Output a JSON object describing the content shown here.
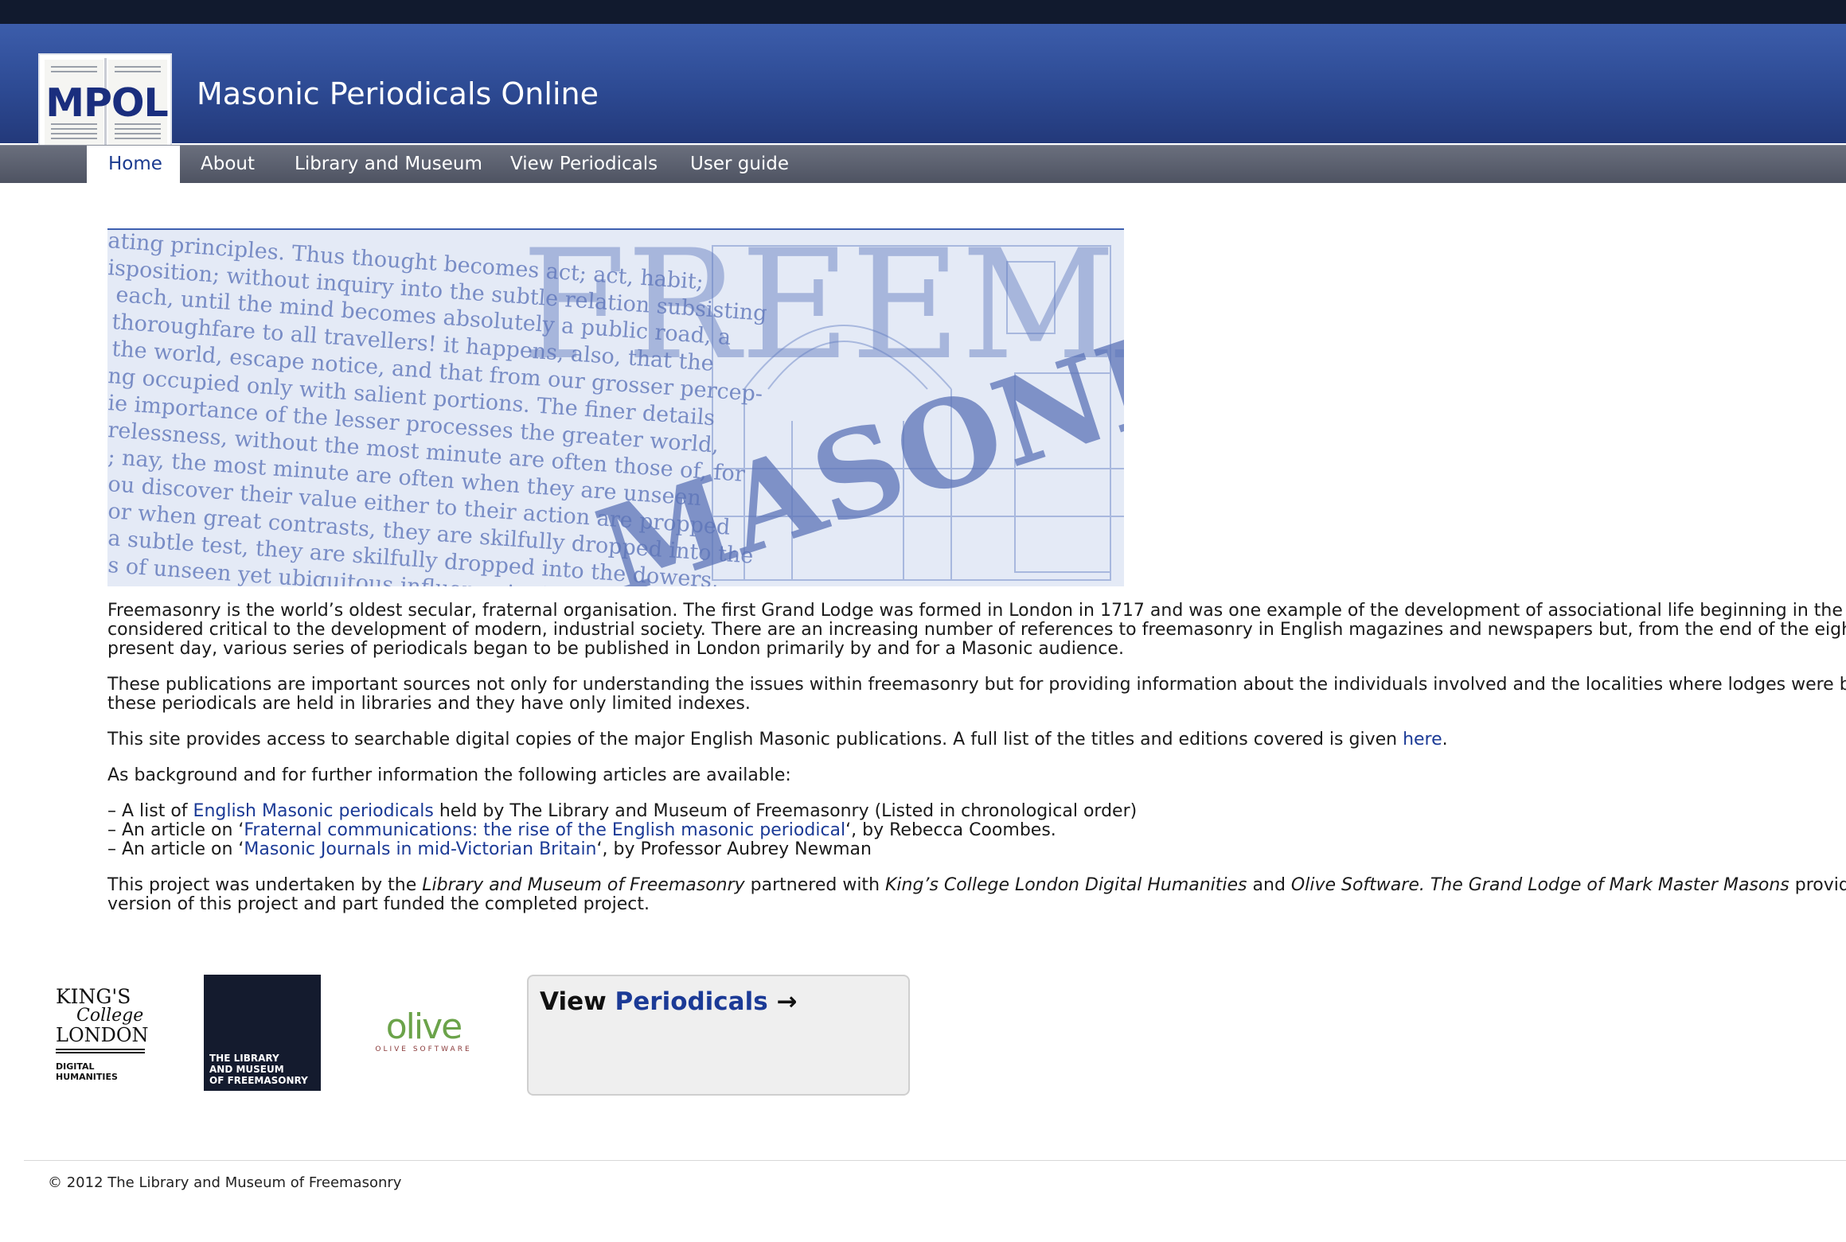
{
  "header": {
    "logo_text": "MPOL",
    "site_title": "Masonic Periodicals Online"
  },
  "nav": {
    "items": [
      {
        "label": "Home",
        "active": true
      },
      {
        "label": "About",
        "active": false
      },
      {
        "label": "Library and Museum",
        "active": false
      },
      {
        "label": "View Periodicals",
        "active": false
      },
      {
        "label": "User guide",
        "active": false
      }
    ]
  },
  "hero": {
    "text_lines": [
      "ating principles. Thus thought becomes act; act, habit;",
      "isposition; without inquiry into the subtle relation subsisting",
      "each, until the mind becomes absolutely a public road, a",
      "thoroughfare to all travellers! it happens, also, that the",
      "the world, escape notice, and that from our grosser percep-",
      "ng occupied only with salient portions. The finer details",
      "ie importance of the lesser processes the greater world,",
      "relessness, without the most minute are often those of, for",
      "; nay, the most minute are often when they are unseen",
      "ou discover their value either to their action are propped",
      "or when great contrasts, they are skilfully dropped into the",
      "a subtle test, they are skilfully dropped into the dowers,",
      "s of unseen yet ubiquitous influence in the journal and"
    ],
    "overlay_word": "MASONIC",
    "overlay_word_2": "FREEMA"
  },
  "content": {
    "p1": "Freemasonry is the world’s oldest secular, fraternal organisation. The first Grand Lodge was formed in London in 1717 and was one example of the development of associational life beginning in the eighteenth century, considered critical to the development of modern, industrial society. There are an increasing number of references to freemasonry in English magazines and newspapers but, from the end of the eighteenth century to the present day, various series of periodicals began to be published in London primarily by and for a Masonic audience.",
    "p1_line1": "Freemasonry is the world’s oldest secular, fraternal organisation. The first Grand Lodge was formed in London in 1717 and was one example of the development of associational life beginning in the eighte",
    "p1_line2": "considered critical to the development of modern, industrial society. There are an increasing number of references to freemasonry in English magazines and newspapers but, from the end of the eighteent",
    "p1_line3": "present day, various series of periodicals began to be published in London primarily by and for a Masonic audience.",
    "p2_line1": "These publications are important sources not only for understanding the issues within freemasonry but for providing information about the individuals involved and the localities where lodges were based.",
    "p2_line2": "these periodicals are held in libraries and they have only limited indexes.",
    "p3_before": "This site provides access to searchable digital copies of the major English Masonic publications. A full list of the titles and editions covered is given ",
    "p3_link": "here",
    "p3_after": ".",
    "p4": "As background and for further information the following articles are available:",
    "bullets": [
      {
        "before": "– A list of ",
        "link": "English Masonic periodicals",
        "after": " held by The Library and Museum of Freemasonry (Listed in chronological order)"
      },
      {
        "before": "– An article on ‘",
        "link": "Fraternal communications: the rise of the English masonic periodical",
        "after": "‘, by Rebecca Coombes."
      },
      {
        "before": "– An article on ‘",
        "link": "Masonic Journals in mid-Victorian Britain",
        "after": "‘, by Professor Aubrey Newman"
      }
    ],
    "p5": {
      "t1": "This project was undertaken by the ",
      "i1": "Library and Museum of Freemasonry",
      "t2": " partnered with ",
      "i2": "King’s College London Digital Humanities",
      "t3": " and ",
      "i3": "Olive Software. The Grand Lodge of Mark Master Masons",
      "t4": " provided fur",
      "line2": "version of this project and part funded the completed project."
    }
  },
  "partners": {
    "kcl": {
      "line1": "KING'S",
      "line2": "College",
      "line3": "LONDON",
      "line4": "DIGITAL HUMANITIES"
    },
    "lmf": {
      "text": "THE LIBRARY\nAND MUSEUM\nOF FREEMASONRY"
    },
    "olive": {
      "name": "olive",
      "tagline": "OLIVE SOFTWARE",
      "color": "#6ba34a"
    }
  },
  "view_box": {
    "prefix": "View ",
    "link": "Periodicals",
    "arrow": "→"
  },
  "footer": {
    "copyright": "© 2012 The Library and Museum of Freemasonry"
  },
  "colors": {
    "banner": "#2d4a93",
    "nav": "#5a5f6e",
    "link": "#1b3a96",
    "top_strip": "#111a2e"
  }
}
